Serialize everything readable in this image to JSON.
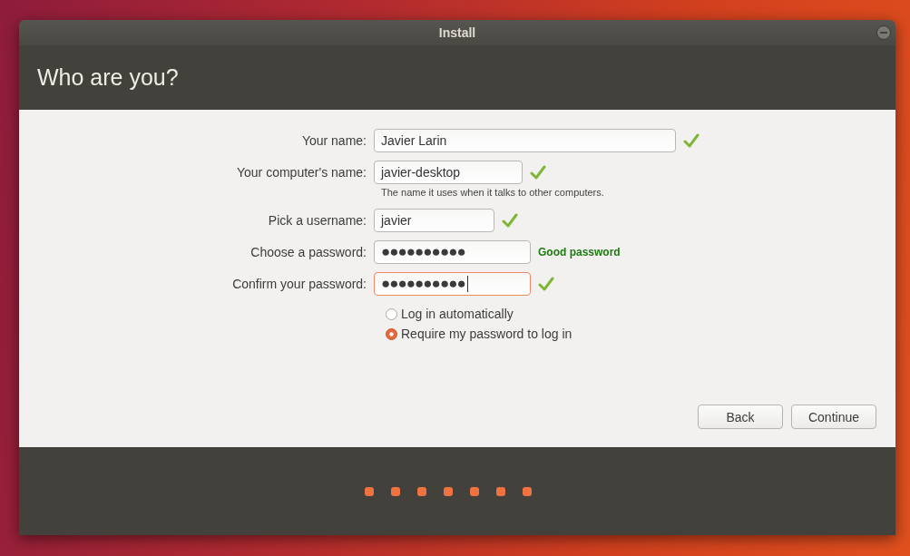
{
  "window": {
    "title": "Install"
  },
  "header": {
    "title": "Who are you?"
  },
  "form": {
    "fields": [
      {
        "label": "Your name:",
        "value": "Javier Larin",
        "kind": "text",
        "focused": false,
        "valid": true
      },
      {
        "label": "Your computer's name:",
        "value": "javier-desktop",
        "kind": "text",
        "focused": false,
        "valid": true,
        "hint": "The name it uses when it talks to other computers."
      },
      {
        "label": "Pick a username:",
        "value": "javier",
        "kind": "text",
        "focused": false,
        "valid": true
      },
      {
        "label": "Choose a password:",
        "value": "●●●●●●●●●●",
        "kind": "password",
        "focused": false,
        "valid": false,
        "strength": "Good password"
      },
      {
        "label": "Confirm your password:",
        "value": "●●●●●●●●●●",
        "kind": "password",
        "focused": true,
        "valid": true
      }
    ],
    "login_options": [
      {
        "label": "Log in automatically",
        "selected": false
      },
      {
        "label": "Require my password to log in",
        "selected": true
      }
    ]
  },
  "buttons": [
    {
      "label": "Back"
    },
    {
      "label": "Continue"
    }
  ]
}
